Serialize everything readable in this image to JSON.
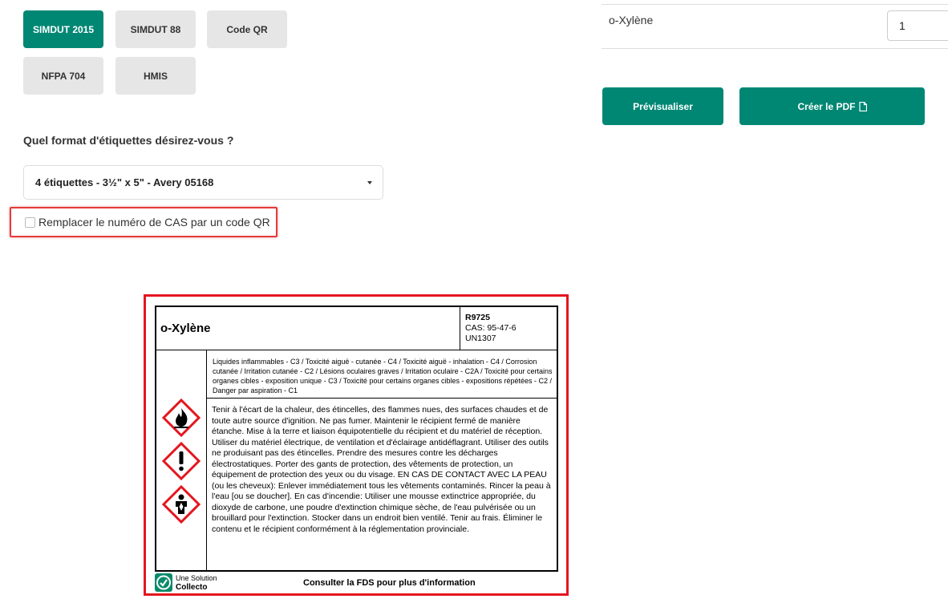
{
  "format_buttons": [
    {
      "label": "SIMDUT 2015",
      "active": true
    },
    {
      "label": "SIMDUT 88",
      "active": false
    },
    {
      "label": "Code QR",
      "active": false
    },
    {
      "label": "NFPA 704",
      "active": false
    },
    {
      "label": "HMIS",
      "active": false
    }
  ],
  "question": "Quel format d'étiquettes désirez-vous ?",
  "label_format_select": {
    "value": "4 étiquettes - 3½\" x 5\" - Avery 05168"
  },
  "cas_checkbox": {
    "label": "Remplacer le numéro de CAS par un code QR",
    "checked": false
  },
  "product_row": {
    "name": "o-Xylène",
    "quantity": "1"
  },
  "actions": {
    "preview": "Prévisualiser",
    "create_pdf": "Créer le PDF"
  },
  "label_preview": {
    "title": "o-Xylène",
    "code": "R9725",
    "cas": "CAS: 95-47-6",
    "un": "UN1307",
    "hazard_classes": "Liquides inflammables - C3 / Toxicité aiguë - cutanée - C4 / Toxicité aiguë - inhalation - C4 / Corrosion cutanée / Irritation cutanée - C2 / Lésions oculaires graves / Irritation oculaire - C2A / Toxicité pour certains organes cibles - exposition unique - C3 / Toxicité pour certains organes cibles - expositions répétées - C2 / Danger par aspiration - C1",
    "precautions": "Tenir à l'écart de la chaleur, des étincelles, des flammes nues, des surfaces chaudes et de toute autre source d'ignition. Ne pas fumer.  Maintenir le récipient fermé de manière étanche. Mise à la terre et liaison équipotentielle du récipient et du matériel de réception. Utiliser du matériel électrique, de ventilation et d'éclairage antidéflagrant. Utiliser des outils ne produisant pas des étincelles. Prendre des mesures contre les décharges électrostatiques. Porter des gants de protection, des vêtements de protection, un équipement de protection des yeux ou du visage. EN CAS DE CONTACT AVEC LA PEAU (ou les cheveux): Enlever immédiatement tous les vêtements contaminés. Rincer la peau à l'eau [ou se doucher]. En cas d'incendie: Utiliser une mousse extinctrice appropriée, du dioxyde de carbone, une poudre d'extinction chimique sèche, de l'eau pulvérisée ou un brouillard pour l'extinction. Stocker dans un endroit bien ventilé. Tenir au frais. Éliminer le contenu et le récipient conformément à la réglementation provinciale.",
    "pictograms": [
      "flame-icon",
      "exclamation-mark-icon",
      "health-hazard-icon"
    ],
    "brand_line1": "Une Solution",
    "brand_line2": "Collecto",
    "footer": "Consulter la FDS pour plus d'information"
  },
  "colors": {
    "accent": "#008774",
    "highlight_border": "#e23b3b",
    "preview_border": "#e4151f",
    "pictogram_red": "#e3161e"
  }
}
